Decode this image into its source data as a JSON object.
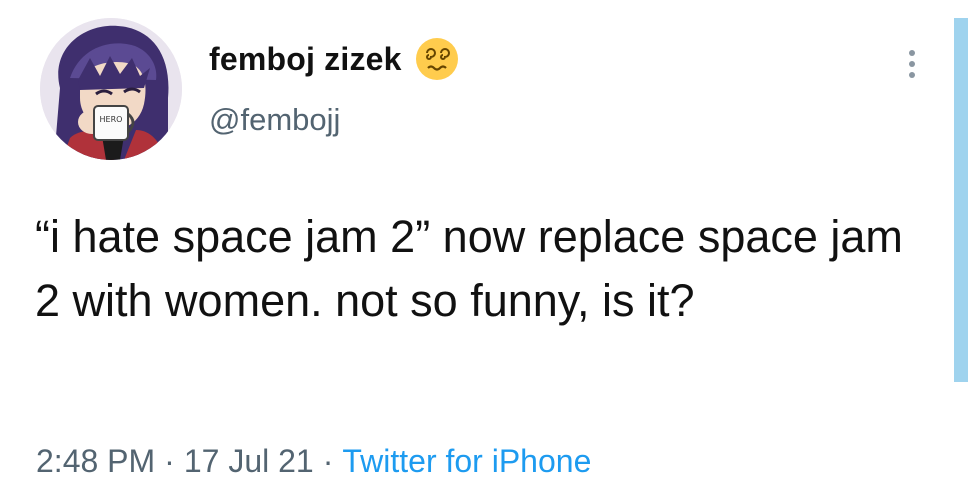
{
  "tweet": {
    "display_name": "femboj zizek",
    "name_emoji": "dizzy-face-emoji",
    "handle": "@fembojj",
    "text": "“i hate space jam 2” now replace space jam 2 with women. not so funny, is it?",
    "time": "2:48 PM",
    "date": "17 Jul 21",
    "source": "Twitter for iPhone",
    "separator": "·",
    "more_icon": "more-vertical-icon",
    "avatar_mug_text": "HERO"
  },
  "colors": {
    "link": "#1d9bf0",
    "secondary": "#536471",
    "side_strip": "#9fd3ee"
  }
}
